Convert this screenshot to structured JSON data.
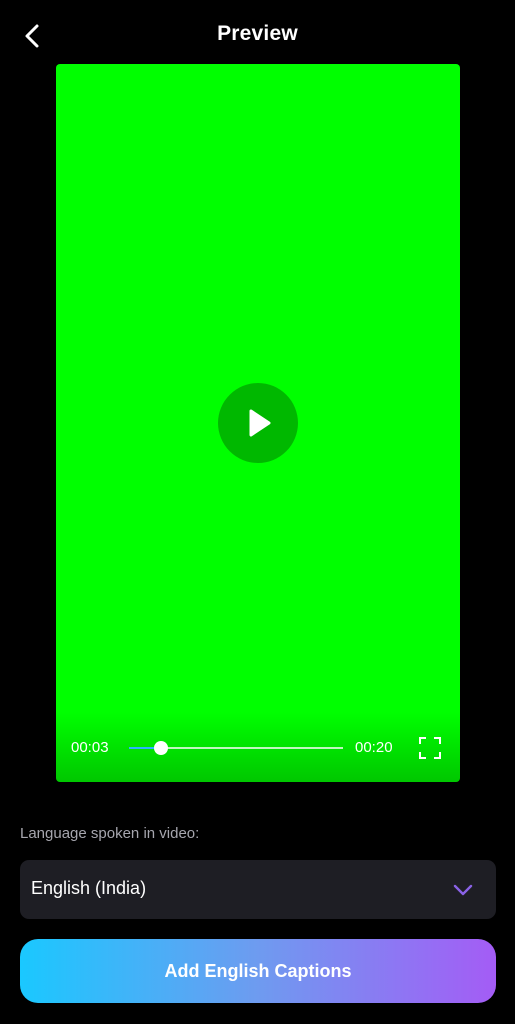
{
  "header": {
    "title": "Preview",
    "back_icon": "chevron-left-icon"
  },
  "video": {
    "background_color": "#00ff00",
    "play_icon": "play-icon",
    "current_time": "00:03",
    "total_time": "00:20",
    "progress_fraction": 0.15,
    "fullscreen_icon": "fullscreen-icon"
  },
  "language": {
    "label": "Language spoken in video:",
    "selected": "English (India)",
    "dropdown_icon": "chevron-down-icon"
  },
  "cta": {
    "label": "Add English Captions",
    "gradient_start": "#1ac8ff",
    "gradient_end": "#a45cf5"
  }
}
